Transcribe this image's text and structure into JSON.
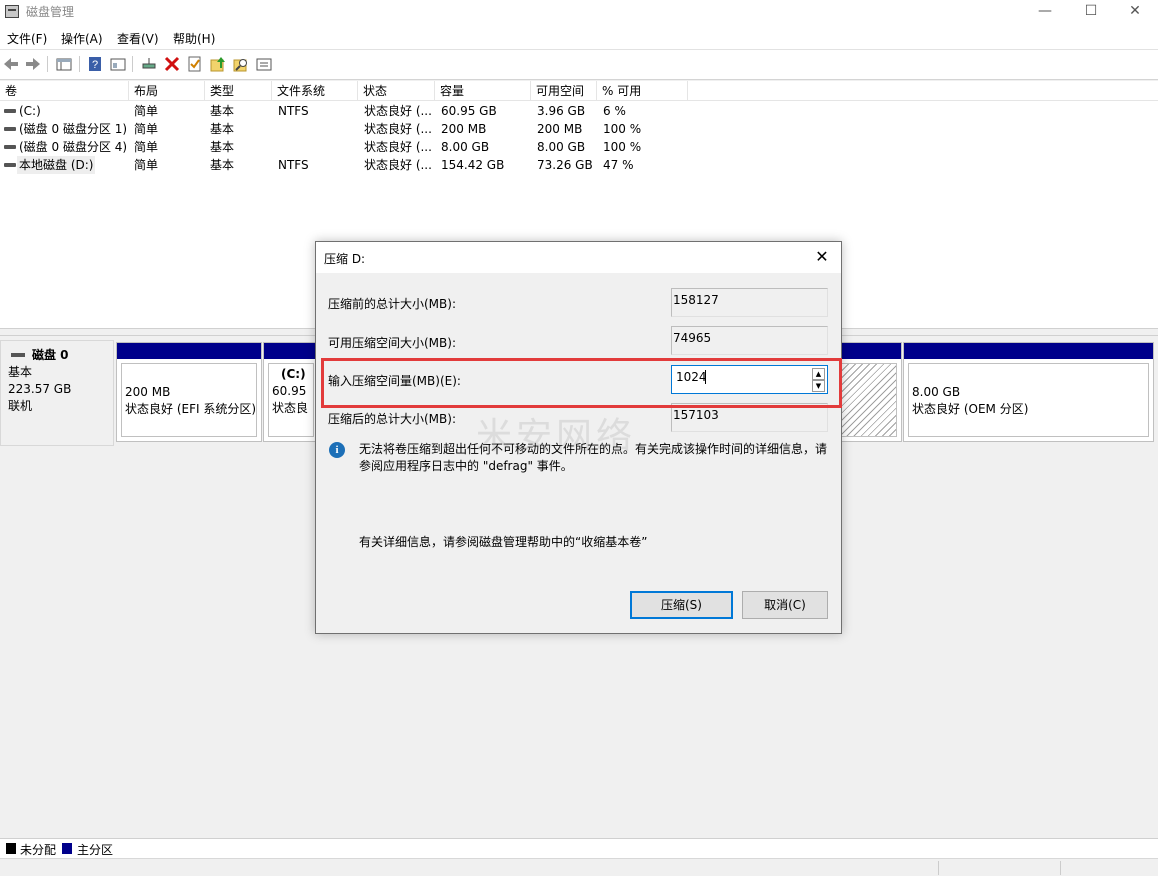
{
  "window": {
    "title": "磁盘管理",
    "min_glyph": "—",
    "max_glyph": "☐",
    "close_glyph": "✕"
  },
  "menu": [
    "文件(F)",
    "操作(A)",
    "查看(V)",
    "帮助(H)"
  ],
  "toolbar": {
    "icons": [
      "back-icon",
      "forward-icon",
      "properties-icon",
      "help-icon",
      "console-icon",
      "connect-icon",
      "delete-icon",
      "check-icon",
      "up-icon",
      "search-icon",
      "details-icon"
    ]
  },
  "volumes": {
    "headers": [
      "卷",
      "布局",
      "类型",
      "文件系统",
      "状态",
      "容量",
      "可用空间",
      "% 可用"
    ],
    "rows": [
      {
        "name": " (C:)",
        "layout": "简单",
        "type": "基本",
        "fs": "NTFS",
        "status": "状态良好 (...",
        "capacity": "60.95 GB",
        "free": "3.96 GB",
        "pct": "6 %"
      },
      {
        "name": "(磁盘 0 磁盘分区 1)",
        "layout": "简单",
        "type": "基本",
        "fs": "",
        "status": "状态良好 (...",
        "capacity": "200 MB",
        "free": "200 MB",
        "pct": "100 %"
      },
      {
        "name": "(磁盘 0 磁盘分区 4)",
        "layout": "简单",
        "type": "基本",
        "fs": "",
        "status": "状态良好 (...",
        "capacity": "8.00 GB",
        "free": "8.00 GB",
        "pct": "100 %"
      },
      {
        "name": "本地磁盘 (D:)",
        "layout": "简单",
        "type": "基本",
        "fs": "NTFS",
        "status": "状态良好 (...",
        "capacity": "154.42 GB",
        "free": "73.26 GB",
        "pct": "47 %"
      }
    ]
  },
  "disk": {
    "name": "磁盘 0",
    "type": "基本",
    "size": "223.57 GB",
    "state": "联机",
    "partitions": [
      {
        "title": "",
        "size": "200 MB",
        "status": "状态良好 (EFI 系统分区)"
      },
      {
        "title": "(C:)",
        "size": "60.95",
        "status": "状态良"
      },
      {
        "title": "",
        "size": "8.00 GB",
        "status": "状态良好 (OEM 分区)"
      }
    ]
  },
  "legend": [
    {
      "label": "未分配",
      "color": "#000000"
    },
    {
      "label": "主分区",
      "color": "#00008b"
    }
  ],
  "dialog": {
    "title": "压缩 D:",
    "close_glyph": "✕",
    "total_before_label": "压缩前的总计大小(MB):",
    "total_before_value": "158127",
    "available_label": "可用压缩空间大小(MB):",
    "available_value": "74965",
    "input_label": "输入压缩空间量(MB)(E):",
    "input_value": "1024",
    "total_after_label": "压缩后的总计大小(MB):",
    "total_after_value": "157103",
    "spin_up": "▲",
    "spin_down": "▼",
    "info_glyph": "i",
    "info_text": "无法将卷压缩到超出任何不可移动的文件所在的点。有关完成该操作时间的详细信息，请参阅应用程序日志中的 \"defrag\" 事件。",
    "help_text": "有关详细信息，请参阅磁盘管理帮助中的“收缩基本卷”",
    "ok_label": "压缩(S)",
    "cancel_label": "取消(C)",
    "highlight_color": "#e23b3b"
  },
  "watermark": "米安网络"
}
